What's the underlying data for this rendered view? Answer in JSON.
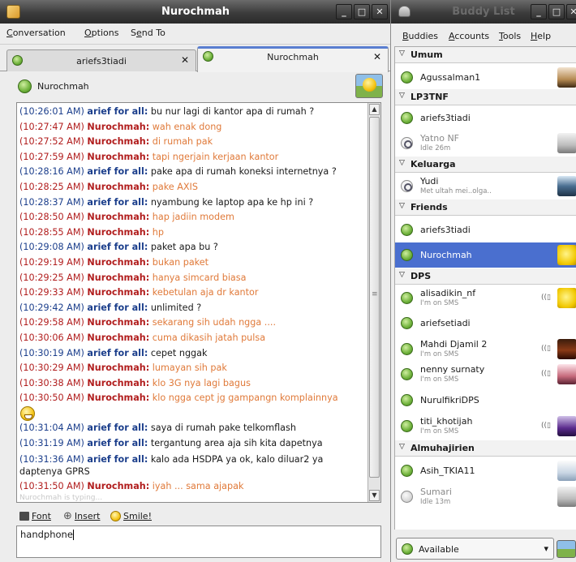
{
  "conversation_window": {
    "title": "Nurochmah",
    "menu": [
      "Conversation",
      "Options",
      "Send To"
    ],
    "tabs": [
      {
        "label": "ariefs3tiadi",
        "active": false
      },
      {
        "label": "Nurochmah",
        "active": true
      }
    ],
    "header_name": "Nurochmah",
    "messages": [
      {
        "ts": "(10:26:01 AM)",
        "nick": "arief for all:",
        "text": "bu nur lagi di kantor apa di rumah ?",
        "from": "a"
      },
      {
        "ts": "(10:27:47 AM)",
        "nick": "Nurochmah:",
        "text": "wah enak dong",
        "from": "n"
      },
      {
        "ts": "(10:27:52 AM)",
        "nick": "Nurochmah:",
        "text": "di rumah pak",
        "from": "n"
      },
      {
        "ts": "(10:27:59 AM)",
        "nick": "Nurochmah:",
        "text": "tapi ngerjain kerjaan kantor",
        "from": "n"
      },
      {
        "ts": "(10:28:16 AM)",
        "nick": "arief for all:",
        "text": "pake apa di rumah koneksi internetnya ?",
        "from": "a"
      },
      {
        "ts": "(10:28:25 AM)",
        "nick": "Nurochmah:",
        "text": "pake AXIS",
        "from": "n"
      },
      {
        "ts": "(10:28:37 AM)",
        "nick": "arief for all:",
        "text": "nyambung ke laptop apa ke hp ini ?",
        "from": "a"
      },
      {
        "ts": "(10:28:50 AM)",
        "nick": "Nurochmah:",
        "text": "hap jadiin modem",
        "from": "n"
      },
      {
        "ts": "(10:28:55 AM)",
        "nick": "Nurochmah:",
        "text": "hp",
        "from": "n"
      },
      {
        "ts": "(10:29:08 AM)",
        "nick": "arief for all:",
        "text": "paket apa bu ?",
        "from": "a"
      },
      {
        "ts": "(10:29:19 AM)",
        "nick": "Nurochmah:",
        "text": "bukan paket",
        "from": "n"
      },
      {
        "ts": "(10:29:25 AM)",
        "nick": "Nurochmah:",
        "text": "hanya simcard biasa",
        "from": "n"
      },
      {
        "ts": "(10:29:33 AM)",
        "nick": "Nurochmah:",
        "text": "kebetulan aja dr kantor",
        "from": "n"
      },
      {
        "ts": "(10:29:42 AM)",
        "nick": "arief for all:",
        "text": "unlimited ?",
        "from": "a"
      },
      {
        "ts": "(10:29:58 AM)",
        "nick": "Nurochmah:",
        "text": "sekarang sih udah ngga ....",
        "from": "n"
      },
      {
        "ts": "(10:30:06 AM)",
        "nick": "Nurochmah:",
        "text": "cuma dikasih jatah pulsa",
        "from": "n"
      },
      {
        "ts": "(10:30:19 AM)",
        "nick": "arief for all:",
        "text": "cepet nggak",
        "from": "a"
      },
      {
        "ts": "(10:30:29 AM)",
        "nick": "Nurochmah:",
        "text": "lumayan sih pak",
        "from": "n"
      },
      {
        "ts": "(10:30:38 AM)",
        "nick": "Nurochmah:",
        "text": "klo 3G nya lagi bagus",
        "from": "n"
      },
      {
        "ts": "(10:30:50 AM)",
        "nick": "Nurochmah:",
        "text": "klo ngga cept jg gampangn komplainnya",
        "from": "n",
        "smiley": true
      },
      {
        "ts": "(10:31:04 AM)",
        "nick": "arief for all:",
        "text": "saya di rumah pake telkomflash",
        "from": "a"
      },
      {
        "ts": "(10:31:19 AM)",
        "nick": "arief for all:",
        "text": "tergantung area aja sih kita dapetnya",
        "from": "a"
      },
      {
        "ts": "(10:31:36 AM)",
        "nick": "arief for all:",
        "text": "kalo ada HSDPA ya ok, kalo diluar2 ya daptenya GPRS",
        "from": "a",
        "wrap": true
      },
      {
        "ts": "(10:31:50 AM)",
        "nick": "Nurochmah:",
        "text": "iyah ... sama ajapak",
        "from": "n"
      }
    ],
    "typing_notice": "Nurochmah is typing...",
    "toolbar": {
      "font": "Font",
      "insert": "Insert",
      "smile": "Smile!"
    },
    "entry_text": "handphone"
  },
  "buddy_list": {
    "title": "Buddy List",
    "menu": [
      "Buddies",
      "Accounts",
      "Tools",
      "Help"
    ],
    "groups": {
      "umum": "Umum",
      "lp3tnf": "LP3TNF",
      "keluarga": "Keluarga",
      "friends": "Friends",
      "dps": "DPS",
      "almuhajirien": "Almuhajirien"
    },
    "buddies": {
      "agussalman1": {
        "name": "Agussalman1"
      },
      "ariefs3tiadi_1": {
        "name": "ariefs3tiadi"
      },
      "yatno": {
        "name": "Yatno NF",
        "sub": "Idle 26m"
      },
      "yudi": {
        "name": "Yudi",
        "sub": "Met ultah mei..olga.."
      },
      "ariefs3tiadi_2": {
        "name": "ariefs3tiadi"
      },
      "nurochmah": {
        "name": "Nurochmah"
      },
      "alisadikin": {
        "name": "alisadikin_nf",
        "sub": "I'm on SMS"
      },
      "ariefsetiadi": {
        "name": "ariefsetiadi"
      },
      "mahdi": {
        "name": "Mahdi Djamil 2",
        "sub": "I'm on SMS"
      },
      "nenny": {
        "name": "nenny surnaty",
        "sub": "I'm on SMS"
      },
      "nurulfikri": {
        "name": "NurulfikriDPS"
      },
      "titi": {
        "name": "titi_khotijah",
        "sub": "I'm on SMS"
      },
      "asih": {
        "name": "Asih_TKIA11"
      },
      "sumari": {
        "name": "Sumari",
        "sub": "Idle 13m"
      }
    },
    "status": "Available"
  },
  "colors": {
    "self_nick": "#1c3f8c",
    "buddy_nick": "#b11d1d",
    "buddy_text": "#e07a3a",
    "selection": "#4a6fcf"
  }
}
